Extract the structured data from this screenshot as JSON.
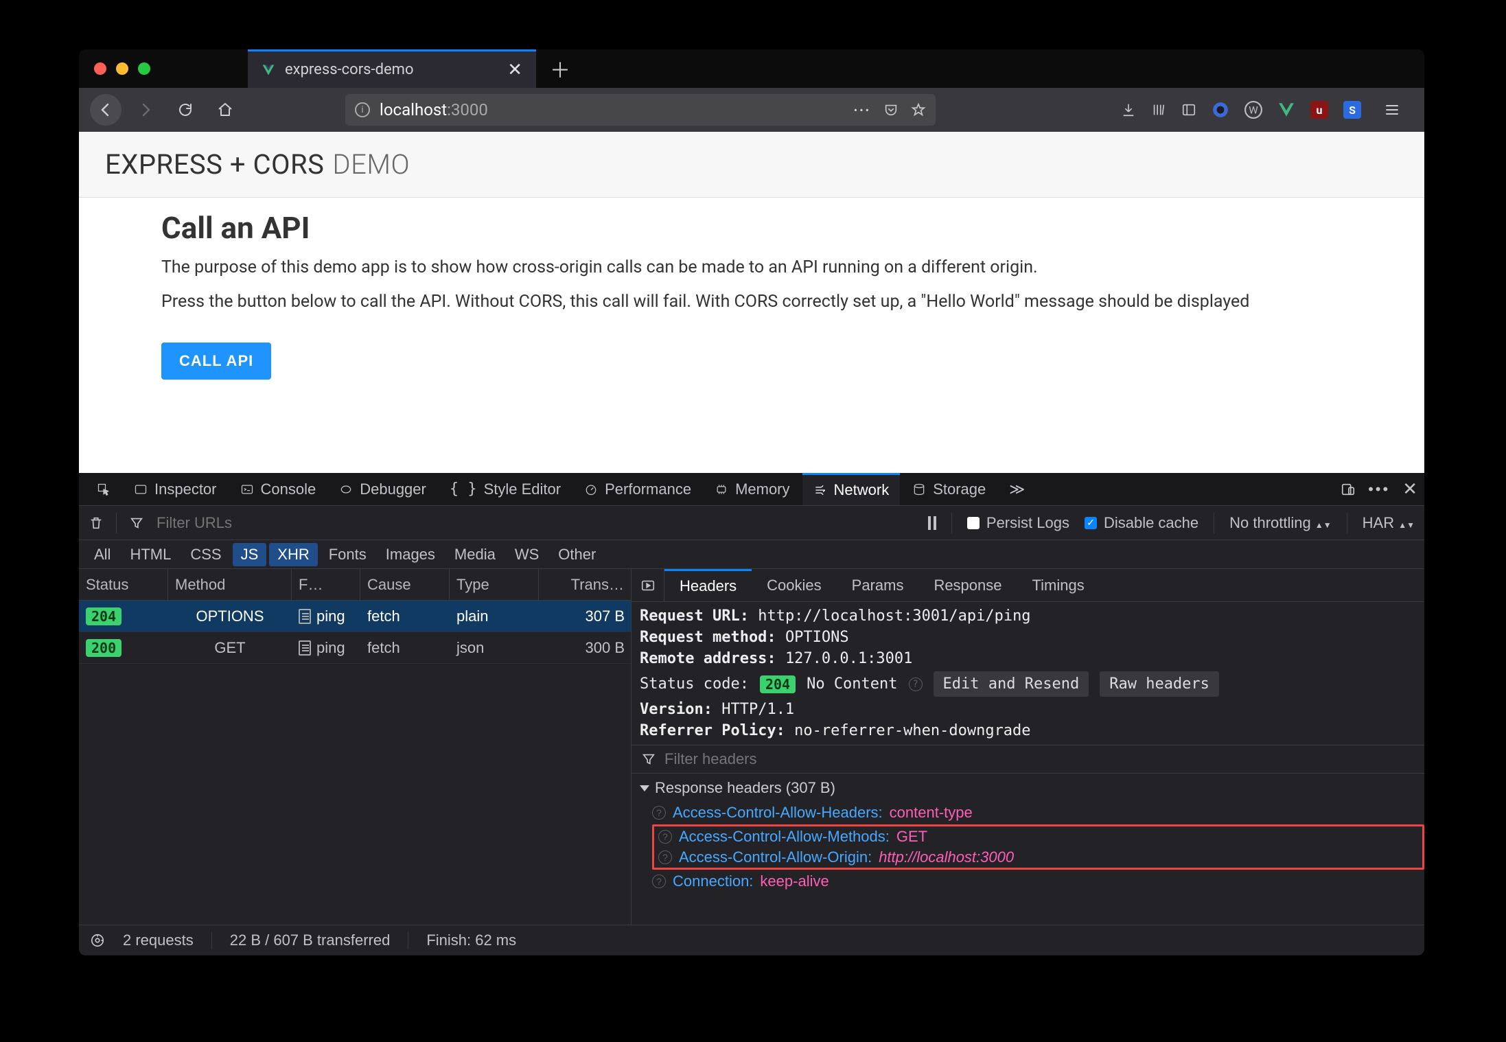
{
  "browser": {
    "tab_title": "express-cors-demo",
    "url_host": "localhost",
    "url_port": ":3000",
    "extensions": {
      "vue": "V",
      "ublock": "uO",
      "stylus": "S",
      "noscript": "W"
    }
  },
  "page": {
    "header_strong": "EXPRESS + CORS",
    "header_thin": "DEMO",
    "h1": "Call an API",
    "p1": "The purpose of this demo app is to show how cross-origin calls can be made to an API running on a different origin.",
    "p2": "Press the button below to call the API. Without CORS, this call will fail. With CORS correctly set up, a \"Hello World\" message should be displayed",
    "button": "CALL API"
  },
  "devtools": {
    "tabs": [
      "Inspector",
      "Console",
      "Debugger",
      "Style Editor",
      "Performance",
      "Memory",
      "Network",
      "Storage"
    ],
    "active_tab": "Network",
    "filter_placeholder": "Filter URLs",
    "persist_label": "Persist Logs",
    "disable_cache_label": "Disable cache",
    "throttling_label": "No throttling",
    "har_label": "HAR",
    "type_filters": [
      "All",
      "HTML",
      "CSS",
      "JS",
      "XHR",
      "Fonts",
      "Images",
      "Media",
      "WS",
      "Other"
    ],
    "columns": [
      "Status",
      "Method",
      "F…",
      "Cause",
      "Type",
      "Trans…"
    ],
    "rows": [
      {
        "status": "204",
        "method": "OPTIONS",
        "file": "ping",
        "cause": "fetch",
        "type": "plain",
        "transferred": "307 B",
        "selected": true
      },
      {
        "status": "200",
        "method": "GET",
        "file": "ping",
        "cause": "fetch",
        "type": "json",
        "transferred": "300 B",
        "selected": false
      }
    ],
    "statusbar": {
      "requests": "2 requests",
      "transferred": "22 B / 607 B transferred",
      "finish": "Finish: 62 ms"
    },
    "detail_tabs": [
      "Headers",
      "Cookies",
      "Params",
      "Response",
      "Timings"
    ],
    "request": {
      "url_label": "Request URL:",
      "url": "http://localhost:3001/api/ping",
      "method_label": "Request method:",
      "method": "OPTIONS",
      "remote_label": "Remote address:",
      "remote": "127.0.0.1:3001",
      "status_label": "Status code:",
      "status_code": "204",
      "status_text": "No Content",
      "edit_resend": "Edit and Resend",
      "raw_headers": "Raw headers",
      "version_label": "Version:",
      "version": "HTTP/1.1",
      "referrer_label": "Referrer Policy:",
      "referrer": "no-referrer-when-downgrade"
    },
    "filter_headers_placeholder": "Filter headers",
    "response_headers_title": "Response headers (307 B)",
    "response_headers": [
      {
        "name": "Access-Control-Allow-Headers:",
        "value": "content-type",
        "hl": false,
        "italic": false
      },
      {
        "name": "Access-Control-Allow-Methods:",
        "value": "GET",
        "hl": true,
        "italic": false
      },
      {
        "name": "Access-Control-Allow-Origin:",
        "value": "http://localhost:3000",
        "hl": true,
        "italic": true
      },
      {
        "name": "Connection:",
        "value": "keep-alive",
        "hl": false,
        "italic": false
      }
    ]
  }
}
